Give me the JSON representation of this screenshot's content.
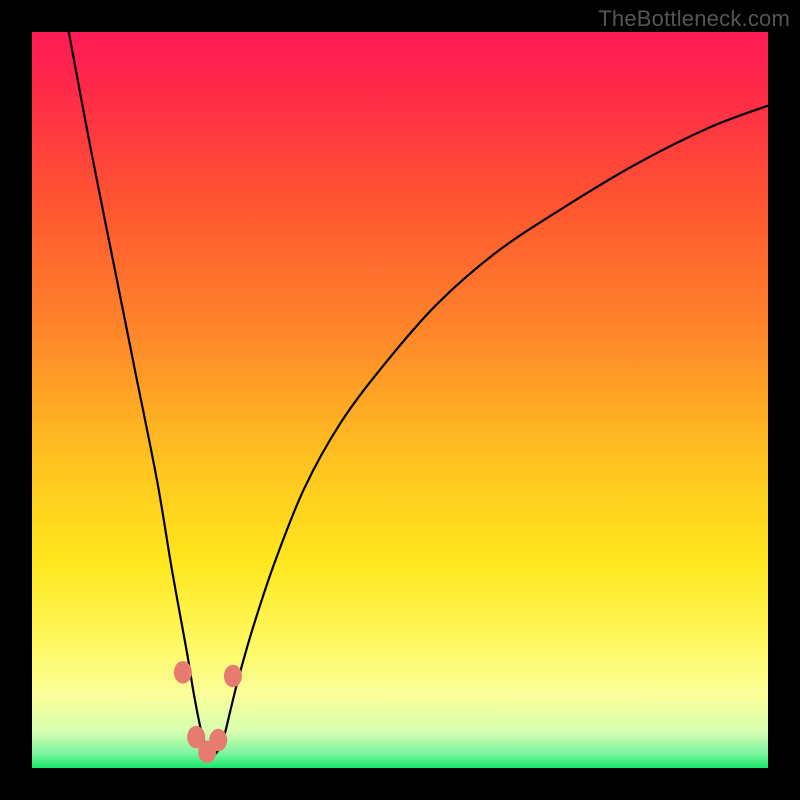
{
  "watermark": "TheBottleneck.com",
  "chart_data": {
    "type": "line",
    "title": "",
    "xlabel": "",
    "ylabel": "",
    "xlim": [
      0,
      100
    ],
    "ylim": [
      0,
      100
    ],
    "gradient_stops": [
      {
        "offset": 0,
        "color": "#ff1a55"
      },
      {
        "offset": 0.08,
        "color": "#ff2a48"
      },
      {
        "offset": 0.25,
        "color": "#ff5a2f"
      },
      {
        "offset": 0.42,
        "color": "#ff8a2a"
      },
      {
        "offset": 0.58,
        "color": "#ffc21f"
      },
      {
        "offset": 0.72,
        "color": "#ffe71e"
      },
      {
        "offset": 0.82,
        "color": "#fff75a"
      },
      {
        "offset": 0.9,
        "color": "#fbff9a"
      },
      {
        "offset": 0.95,
        "color": "#d8ffb0"
      },
      {
        "offset": 0.98,
        "color": "#7df5a0"
      },
      {
        "offset": 1.0,
        "color": "#17e66b"
      }
    ],
    "curve": {
      "description": "V-shaped bottleneck curve; minimum near x≈24, asymmetric, right arm rises with diminishing slope",
      "x": [
        5,
        8,
        11,
        14,
        17,
        19,
        21,
        22,
        23,
        24,
        25,
        26,
        27,
        28,
        30,
        33,
        37,
        42,
        48,
        55,
        63,
        72,
        82,
        92,
        100
      ],
      "y": [
        100,
        84,
        69,
        54,
        39,
        27,
        16,
        10,
        5,
        2,
        2,
        4,
        8,
        12,
        19,
        28,
        38,
        47,
        55,
        63,
        70,
        76,
        82,
        87,
        90
      ]
    },
    "markers": {
      "description": "small salmon dots near trough",
      "color": "#e77b70",
      "radius_px": 9,
      "points": [
        {
          "x": 20.5,
          "y": 13
        },
        {
          "x": 22.3,
          "y": 4.2
        },
        {
          "x": 23.8,
          "y": 2.2
        },
        {
          "x": 25.3,
          "y": 3.8
        },
        {
          "x": 27.3,
          "y": 12.5
        }
      ]
    }
  }
}
